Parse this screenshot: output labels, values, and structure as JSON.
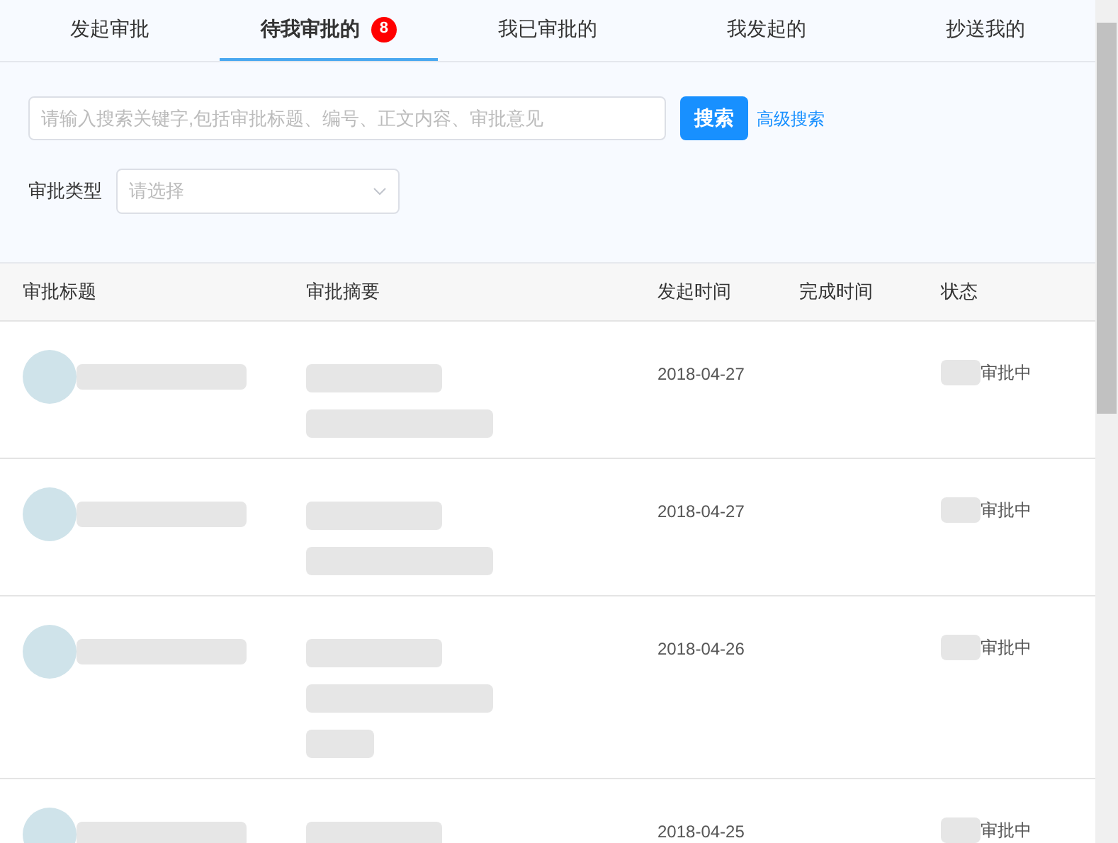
{
  "tabs": [
    {
      "label": "发起审批",
      "selected": false
    },
    {
      "label": "待我审批的",
      "selected": true,
      "badge": "8"
    },
    {
      "label": "我已审批的",
      "selected": false
    },
    {
      "label": "我发起的",
      "selected": false
    },
    {
      "label": "抄送我的",
      "selected": false
    }
  ],
  "search": {
    "placeholder": "请输入搜索关键字,包括审批标题、编号、正文内容、审批意见",
    "button": "搜索",
    "advanced_link": "高级搜索"
  },
  "filter": {
    "label": "审批类型",
    "placeholder": "请选择"
  },
  "table": {
    "columns": [
      "审批标题",
      "审批摘要",
      "发起时间",
      "完成时间",
      "状态"
    ],
    "rows": [
      {
        "date": "2018-04-27",
        "status": "审批中",
        "summary_redactions": [
          {
            "kind": "short"
          },
          {
            "kind": "long"
          }
        ]
      },
      {
        "date": "2018-04-27",
        "status": "审批中",
        "summary_redactions": [
          {
            "kind": "short"
          },
          {
            "kind": "long"
          }
        ]
      },
      {
        "date": "2018-04-26",
        "status": "审批中",
        "summary_redactions": [
          {
            "kind": "short"
          },
          {
            "kind": "long"
          },
          {
            "kind": "tiny"
          }
        ]
      },
      {
        "date": "2018-04-25",
        "status": "审批中",
        "summary_redactions": [
          {
            "kind": "short"
          }
        ]
      }
    ]
  }
}
